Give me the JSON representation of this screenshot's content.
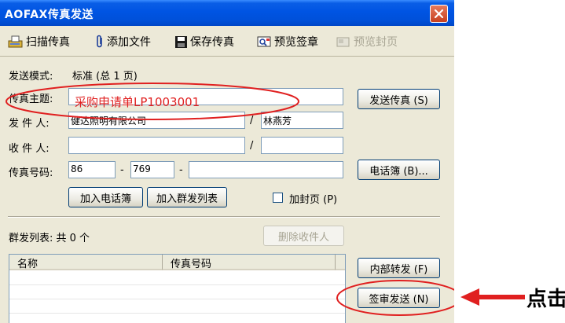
{
  "window": {
    "title": "AOFAX传真发送"
  },
  "toolbar": {
    "scan": "扫描传真",
    "add_file": "添加文件",
    "save_fax": "保存传真",
    "preview_sign": "预览签章",
    "preview_cover": "预览封页"
  },
  "send": {
    "mode_label": "发送模式:",
    "mode_value": "标准 (总 1 页)",
    "subject_label": "传真主题:",
    "subject_value": "采购申请单LP1003001",
    "sender_label": "发 件 人:",
    "sender_company": "健达照明有限公司",
    "sender_name": "林燕芳",
    "recipient_label": "收 件 人:",
    "recipient_company": "",
    "recipient_name": "",
    "slash": "/",
    "fax_label": "传真号码:",
    "fax_country": "86",
    "fax_area": "769",
    "fax_number": "",
    "dash": "-"
  },
  "buttons": {
    "send_fax": "发送传真 (S)",
    "phonebook": "电话簿 (B)...",
    "add_phonebook": "加入电话簿",
    "add_group": "加入群发列表",
    "add_cover": "加封页 (P)",
    "remove_recipient": "删除收件人",
    "internal_forward": "内部转发 (F)",
    "sign_send": "签审发送 (N)"
  },
  "group": {
    "label": "群发列表: 共 0 个",
    "columns": [
      "名称",
      "传真号码"
    ]
  },
  "annotation": {
    "click_text": "点击"
  },
  "colors": {
    "titlebar": "#0054e3",
    "window_bg": "#ece9d8",
    "annotation_red": "#e02020"
  }
}
